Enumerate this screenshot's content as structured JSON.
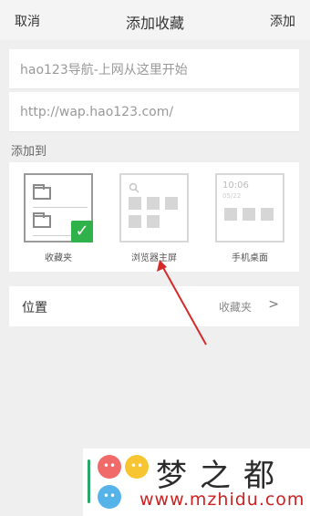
{
  "topbar": {
    "cancel": "取消",
    "title": "添加收藏",
    "add": "添加"
  },
  "form": {
    "title_value": "hao123导航-上网从这里开始",
    "url_value": "http://wap.hao123.com/"
  },
  "add_to": {
    "label": "添加到",
    "options": [
      {
        "label": "收藏夹",
        "selected": true
      },
      {
        "label": "浏览器主屏",
        "selected": false
      },
      {
        "label": "手机桌面",
        "selected": false
      }
    ],
    "check_mark": "✓",
    "desktop_clock": "10:06",
    "desktop_date": "05/22"
  },
  "position": {
    "label": "位置",
    "value": "收藏夹",
    "chevron": ">"
  },
  "watermark": {
    "title": "梦之都",
    "url": "www.mzhidu.com"
  },
  "colors": {
    "accent_check": "#2fb24a",
    "arrow": "#d42a2a",
    "background": "#efefef"
  },
  "icons": {
    "folder": "folder-icon",
    "search": "search-icon",
    "check": "check-icon",
    "chevron": "chevron-right-icon"
  }
}
